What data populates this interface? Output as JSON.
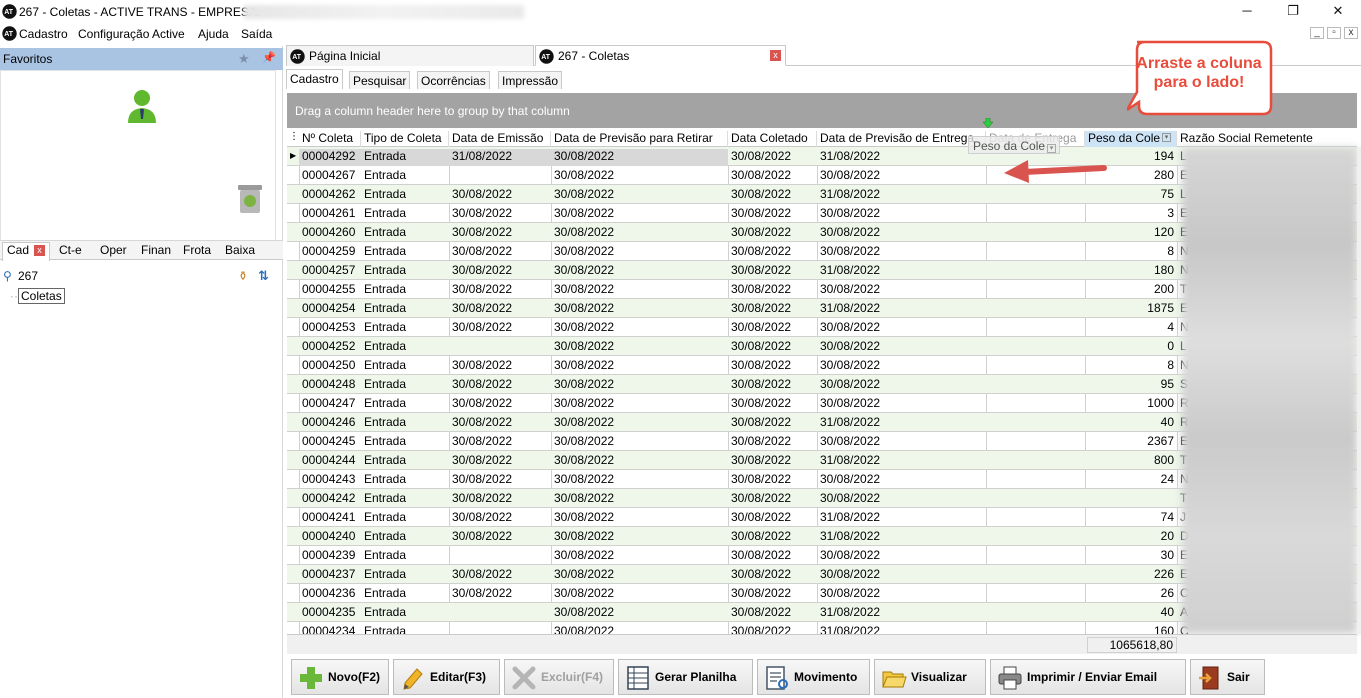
{
  "window": {
    "title": "267 - Coletas - ACTIVE TRANS - EMPRESA:",
    "controls": {
      "minimize": "─",
      "maximize": "❐",
      "close": "✕"
    }
  },
  "menubar": {
    "items": [
      "Cadastro",
      "Configuração Active",
      "Ajuda",
      "Saída"
    ],
    "mdi": {
      "minimize": "_",
      "restore": "▫",
      "close": "x"
    }
  },
  "favoritos": {
    "title": "Favoritos"
  },
  "left_tabs": [
    "Cad",
    "Ct-e",
    "Oper",
    "Finan",
    "Frota",
    "Baixa"
  ],
  "search": {
    "value": "267"
  },
  "tree": {
    "item": "Coletas"
  },
  "doc_tabs": [
    {
      "label": "Página Inicial"
    },
    {
      "label": "267 - Coletas"
    }
  ],
  "sub_tabs": [
    "Cadastro",
    "Pesquisar",
    "Ocorrências",
    "Impressão"
  ],
  "group_bar": "Drag a column header here to group by that column",
  "grid": {
    "columns": [
      "Nº Coleta",
      "Tipo de Coleta",
      "Data de Emissão",
      "Data de Previsão para Retirar",
      "Data Coletado",
      "Data de Previsão de Entrega",
      "Data de Entrega",
      "Peso da Cole",
      "Razão Social Remetente"
    ],
    "drag_ghost": "Peso da Cole",
    "rows": [
      [
        "00004292",
        "Entrada",
        "31/08/2022",
        "30/08/2022",
        "30/08/2022",
        "31/08/2022",
        "",
        "194",
        "L"
      ],
      [
        "00004267",
        "Entrada",
        "",
        "30/08/2022",
        "30/08/2022",
        "30/08/2022",
        "",
        "280",
        "E"
      ],
      [
        "00004262",
        "Entrada",
        "30/08/2022",
        "30/08/2022",
        "30/08/2022",
        "31/08/2022",
        "",
        "75",
        "L"
      ],
      [
        "00004261",
        "Entrada",
        "30/08/2022",
        "30/08/2022",
        "30/08/2022",
        "30/08/2022",
        "",
        "3",
        "E"
      ],
      [
        "00004260",
        "Entrada",
        "30/08/2022",
        "30/08/2022",
        "30/08/2022",
        "30/08/2022",
        "",
        "120",
        "E"
      ],
      [
        "00004259",
        "Entrada",
        "30/08/2022",
        "30/08/2022",
        "30/08/2022",
        "30/08/2022",
        "",
        "8",
        "N"
      ],
      [
        "00004257",
        "Entrada",
        "30/08/2022",
        "30/08/2022",
        "30/08/2022",
        "31/08/2022",
        "",
        "180",
        "N"
      ],
      [
        "00004255",
        "Entrada",
        "30/08/2022",
        "30/08/2022",
        "30/08/2022",
        "30/08/2022",
        "",
        "200",
        "T"
      ],
      [
        "00004254",
        "Entrada",
        "30/08/2022",
        "30/08/2022",
        "30/08/2022",
        "31/08/2022",
        "",
        "1875",
        "E"
      ],
      [
        "00004253",
        "Entrada",
        "30/08/2022",
        "30/08/2022",
        "30/08/2022",
        "30/08/2022",
        "",
        "4",
        "N"
      ],
      [
        "00004252",
        "Entrada",
        "",
        "30/08/2022",
        "30/08/2022",
        "30/08/2022",
        "",
        "0",
        "L"
      ],
      [
        "00004250",
        "Entrada",
        "30/08/2022",
        "30/08/2022",
        "30/08/2022",
        "30/08/2022",
        "",
        "8",
        "N"
      ],
      [
        "00004248",
        "Entrada",
        "30/08/2022",
        "30/08/2022",
        "30/08/2022",
        "30/08/2022",
        "",
        "95",
        "S"
      ],
      [
        "00004247",
        "Entrada",
        "30/08/2022",
        "30/08/2022",
        "30/08/2022",
        "30/08/2022",
        "",
        "1000",
        "R"
      ],
      [
        "00004246",
        "Entrada",
        "30/08/2022",
        "30/08/2022",
        "30/08/2022",
        "31/08/2022",
        "",
        "40",
        "R"
      ],
      [
        "00004245",
        "Entrada",
        "30/08/2022",
        "30/08/2022",
        "30/08/2022",
        "30/08/2022",
        "",
        "2367",
        "E"
      ],
      [
        "00004244",
        "Entrada",
        "30/08/2022",
        "30/08/2022",
        "30/08/2022",
        "31/08/2022",
        "",
        "800",
        "T"
      ],
      [
        "00004243",
        "Entrada",
        "30/08/2022",
        "30/08/2022",
        "30/08/2022",
        "30/08/2022",
        "",
        "24",
        "N"
      ],
      [
        "00004242",
        "Entrada",
        "30/08/2022",
        "30/08/2022",
        "30/08/2022",
        "30/08/2022",
        "",
        "",
        "T"
      ],
      [
        "00004241",
        "Entrada",
        "30/08/2022",
        "30/08/2022",
        "30/08/2022",
        "31/08/2022",
        "",
        "74",
        "J"
      ],
      [
        "00004240",
        "Entrada",
        "30/08/2022",
        "30/08/2022",
        "30/08/2022",
        "31/08/2022",
        "",
        "20",
        "D"
      ],
      [
        "00004239",
        "Entrada",
        "",
        "30/08/2022",
        "30/08/2022",
        "30/08/2022",
        "",
        "30",
        "E"
      ],
      [
        "00004237",
        "Entrada",
        "30/08/2022",
        "30/08/2022",
        "30/08/2022",
        "30/08/2022",
        "",
        "226",
        "E"
      ],
      [
        "00004236",
        "Entrada",
        "30/08/2022",
        "30/08/2022",
        "30/08/2022",
        "30/08/2022",
        "",
        "26",
        "C"
      ],
      [
        "00004235",
        "Entrada",
        "",
        "30/08/2022",
        "30/08/2022",
        "31/08/2022",
        "",
        "40",
        "A"
      ],
      [
        "00004234",
        "Entrada",
        "",
        "30/08/2022",
        "30/08/2022",
        "31/08/2022",
        "",
        "160",
        "C"
      ]
    ],
    "total_peso": "1065618,80"
  },
  "toolbar": [
    {
      "label": "Novo(F2)",
      "icon": "plus-icon",
      "enabled": true
    },
    {
      "label": "Editar(F3)",
      "icon": "pencil-icon",
      "enabled": true
    },
    {
      "label": "Excluir(F4)",
      "icon": "delete-x-icon",
      "enabled": false
    },
    {
      "label": "Gerar Planilha",
      "icon": "spreadsheet-icon",
      "enabled": true
    },
    {
      "label": "Movimento",
      "icon": "report-icon",
      "enabled": true
    },
    {
      "label": "Visualizar",
      "icon": "folder-open-icon",
      "enabled": true
    },
    {
      "label": "Imprimir / Enviar Email",
      "icon": "printer-icon",
      "enabled": true
    },
    {
      "label": "Sair",
      "icon": "exit-door-icon",
      "enabled": true
    }
  ],
  "callout": {
    "text": "Arraste a coluna para o lado!",
    "color": "#e74c3c"
  },
  "colors": {
    "row_alt": "#eef7ea",
    "group_bar": "#a3a3a3",
    "fav_header": "#a9c4e3",
    "header_highlight": "#cde4f7",
    "accent_red": "#d9534f"
  }
}
